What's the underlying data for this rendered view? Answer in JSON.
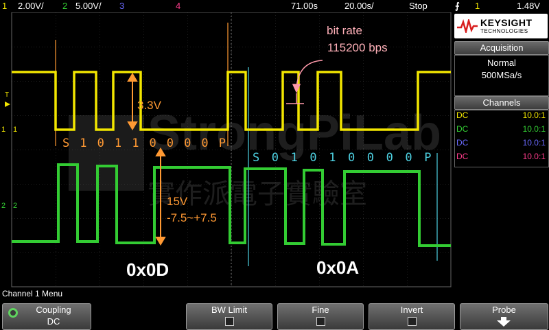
{
  "topbar": {
    "ch1_num": "1",
    "ch1_scale": "2.00V/",
    "ch2_num": "2",
    "ch2_scale": "5.00V/",
    "ch3_num": "3",
    "ch4_num": "4",
    "delay": "71.00s",
    "timebase": "20.00s/",
    "run_state": "Stop",
    "trigger_source": "1",
    "trigger_level": "1.48V",
    "colors": {
      "ch1": "#f2e600",
      "ch2": "#33cc33",
      "ch3": "#6a6aff",
      "ch4": "#ff3c8c"
    }
  },
  "panel": {
    "brand": "KEYSIGHT",
    "brand_sub": "TECHNOLOGIES",
    "acq_title": "Acquisition",
    "acq_mode": "Normal",
    "acq_rate": "500MSa/s",
    "channels_title": "Channels",
    "channels": [
      {
        "coupling": "DC",
        "probe": "10.0:1",
        "color": "#f2e600"
      },
      {
        "coupling": "DC",
        "probe": "10.0:1",
        "color": "#33cc33"
      },
      {
        "coupling": "DC",
        "probe": "10.0:1",
        "color": "#6a6aff"
      },
      {
        "coupling": "DC",
        "probe": "10.0:1",
        "color": "#ff3c8c"
      }
    ]
  },
  "screen": {
    "marker_T": "T",
    "marker_ch1": "1",
    "marker_ch2": "2",
    "annotations": {
      "bit_rate_1": "bit rate",
      "bit_rate_2": "115200 bps",
      "v33": "3.3V",
      "v15": "15V",
      "v75": "-7.5~+7.5",
      "bits_ttl": [
        "S",
        "1",
        "0",
        "1",
        "1",
        "0",
        "0",
        "0",
        "0",
        "P"
      ],
      "bits_rs232": [
        "S",
        "0",
        "1",
        "0",
        "1",
        "0",
        "0",
        "0",
        "0",
        "P"
      ],
      "hex_1": "0x0D",
      "hex_2": "0x0A",
      "watermark": "StrongPiLab",
      "watermark_cn": "實作派電子實驗室"
    }
  },
  "menu": {
    "title": "Channel 1 Menu",
    "coupling_label": "Coupling",
    "coupling_value": "DC",
    "bw_limit": "BW Limit",
    "fine": "Fine",
    "invert": "Invert",
    "probe": "Probe"
  }
}
